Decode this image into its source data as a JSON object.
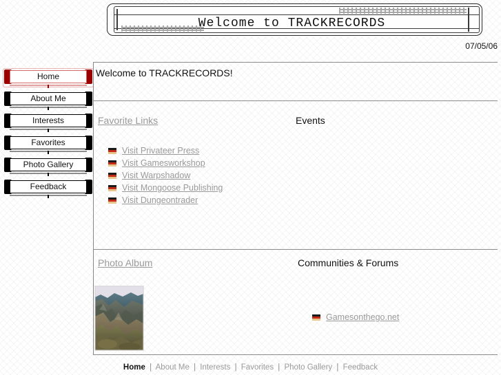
{
  "banner": {
    "title": "Welcome to TRACKRECORDS",
    "date": "07/05/06"
  },
  "sidebar": {
    "items": [
      {
        "label": "Home",
        "active": true
      },
      {
        "label": "About Me",
        "active": false
      },
      {
        "label": "Interests",
        "active": false
      },
      {
        "label": "Favorites",
        "active": false
      },
      {
        "label": "Photo Gallery",
        "active": false
      },
      {
        "label": "Feedback",
        "active": false
      }
    ]
  },
  "main": {
    "welcome_heading": "Welcome to TRACKRECORDS!",
    "sections": {
      "favorite_links": "Favorite Links",
      "events": "Events",
      "photo_album": "Photo Album",
      "communities": "Communities & Forums"
    },
    "favorite_links": [
      {
        "label": "Visit Privateer Press",
        "icon": "german-flag-icon"
      },
      {
        "label": "Visit Gamesworkshop",
        "icon": "german-flag-icon"
      },
      {
        "label": "Visit Warpshadow",
        "icon": "german-flag-icon"
      },
      {
        "label": "Visit Mongoose Publishing",
        "icon": "german-flag-icon"
      },
      {
        "label": "Visit Dungeontrader",
        "icon": "german-flag-icon"
      }
    ],
    "communities": [
      {
        "label": "Gamesonthego.net",
        "icon": "german-flag-icon"
      }
    ],
    "photo": {
      "alt": "mountain canyon landscape photo"
    }
  },
  "footer": {
    "separator": "|",
    "items": [
      {
        "label": "Home",
        "current": true
      },
      {
        "label": "About Me",
        "current": false
      },
      {
        "label": "Interests",
        "current": false
      },
      {
        "label": "Favorites",
        "current": false
      },
      {
        "label": "Photo Gallery",
        "current": false
      },
      {
        "label": "Feedback",
        "current": false
      }
    ]
  },
  "colors": {
    "accent_red": "#9b0000",
    "link_gray": "#9a9a9a",
    "rule_gray": "#8a8a8a",
    "flag_black": "#1a1a1a",
    "flag_red": "#c42b17",
    "flag_gold": "#e8c58a"
  }
}
